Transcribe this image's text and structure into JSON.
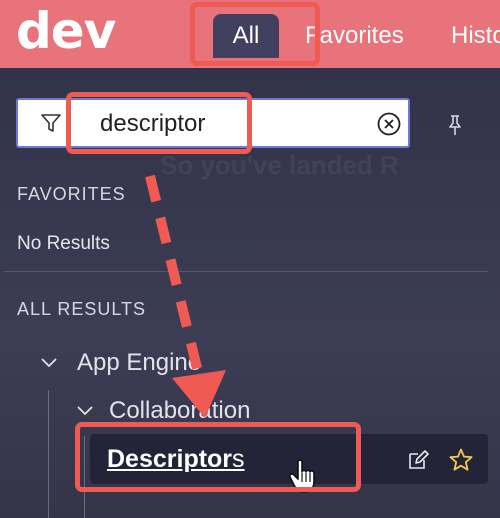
{
  "header": {
    "logo": "dev",
    "tabs": [
      {
        "label": "All",
        "active": true
      },
      {
        "label": "Favorites",
        "active": false
      },
      {
        "label": "History",
        "active": false
      }
    ]
  },
  "filter": {
    "value": "descriptor",
    "icon": "filter-icon",
    "clear_icon": "clear-circle-x-icon"
  },
  "pin_icon": "pin-icon",
  "favorites": {
    "heading": "FAVORITES",
    "empty_text": "No Results"
  },
  "all_results": {
    "heading": "ALL RESULTS",
    "tree": [
      {
        "label": "App Engine",
        "expanded": true
      },
      {
        "label": "Collaboration",
        "expanded": true
      }
    ],
    "result": {
      "match": "Descriptor",
      "rest": "s",
      "actions": [
        "edit-icon",
        "star-icon"
      ]
    }
  },
  "background_text": "So you've landed R",
  "colors": {
    "header_bg": "#e8737b",
    "panel_bg": "#2f3047",
    "active_tab_bg": "#433f5e",
    "filter_border": "#6e78d8",
    "callout": "#ef5a52",
    "star": "#f2c94c"
  }
}
